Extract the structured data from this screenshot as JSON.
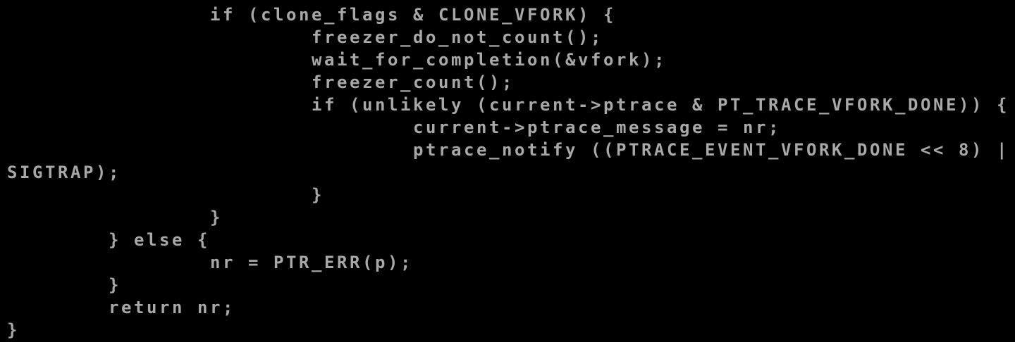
{
  "terminal": {
    "foreground": "#a8a8a8",
    "background": "#000000",
    "lines": [
      "\t\tif (clone_flags & CLONE_VFORK) {",
      "\t\t\tfreezer_do_not_count();",
      "\t\t\twait_for_completion(&vfork);",
      "\t\t\tfreezer_count();",
      "\t\t\tif (unlikely (current->ptrace & PT_TRACE_VFORK_DONE)) {",
      "\t\t\t\tcurrent->ptrace_message = nr;",
      "\t\t\t\tptrace_notify ((PTRACE_EVENT_VFORK_DONE << 8) |",
      "SIGTRAP);",
      "\t\t\t}",
      "\t\t}",
      "\t} else {",
      "\t\tnr = PTR_ERR(p);",
      "\t}",
      "\treturn nr;",
      "}"
    ]
  }
}
